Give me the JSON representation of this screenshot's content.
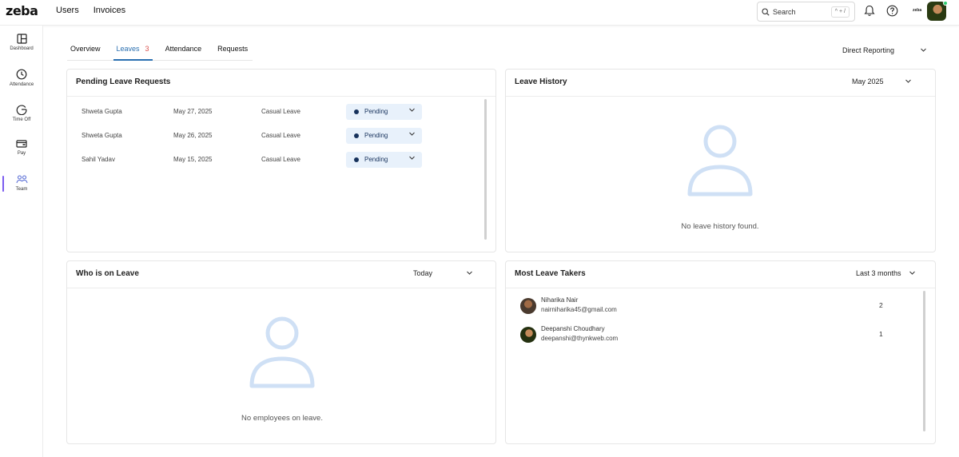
{
  "app": {
    "logo": "zeba",
    "nav": [
      "Users",
      "Invoices"
    ],
    "search": {
      "placeholder": "Search",
      "shortcut": "^ + /"
    },
    "company_mark": "zeba"
  },
  "sidebar": {
    "items": [
      {
        "label": "Dashboard",
        "icon": "dashboard-icon"
      },
      {
        "label": "Attendance",
        "icon": "clock-icon"
      },
      {
        "label": "Time Off",
        "icon": "time-off-icon"
      },
      {
        "label": "Pay",
        "icon": "wallet-icon"
      },
      {
        "label": "Team",
        "icon": "team-icon"
      }
    ],
    "active": "Team",
    "accent": "#7b5cf0"
  },
  "tabs": {
    "items": [
      {
        "label": "Overview"
      },
      {
        "label": "Leaves",
        "count": "3"
      },
      {
        "label": "Attendance"
      },
      {
        "label": "Requests"
      }
    ],
    "active": "Leaves"
  },
  "filter": {
    "direct_reporting": "Direct Reporting"
  },
  "pending": {
    "title": "Pending Leave Requests",
    "rows": [
      {
        "name": "Shweta Gupta",
        "date": "May 27, 2025",
        "type": "Casual Leave",
        "status": "Pending"
      },
      {
        "name": "Shweta Gupta",
        "date": "May 26, 2025",
        "type": "Casual Leave",
        "status": "Pending"
      },
      {
        "name": "Sahil Yadav",
        "date": "May 15, 2025",
        "type": "Casual Leave",
        "status": "Pending"
      }
    ]
  },
  "history": {
    "title": "Leave History",
    "filter": "May 2025",
    "empty": "No leave history found."
  },
  "on_leave": {
    "title": "Who is on Leave",
    "filter": "Today",
    "empty": "No employees on leave."
  },
  "takers": {
    "title": "Most Leave Takers",
    "filter": "Last 3 months",
    "rows": [
      {
        "name": "Niharika Nair",
        "email": "nairniharika45@gmail.com",
        "count": "2"
      },
      {
        "name": "Deepanshi Choudhary",
        "email": "deepanshi@thynkweb.com",
        "count": "1"
      }
    ]
  },
  "colors": {
    "tab_active": "#2a6fb0",
    "pill_bg": "#e8f1fb",
    "empty_icon": "#cfe0f5",
    "count_red": "#d9534f"
  }
}
